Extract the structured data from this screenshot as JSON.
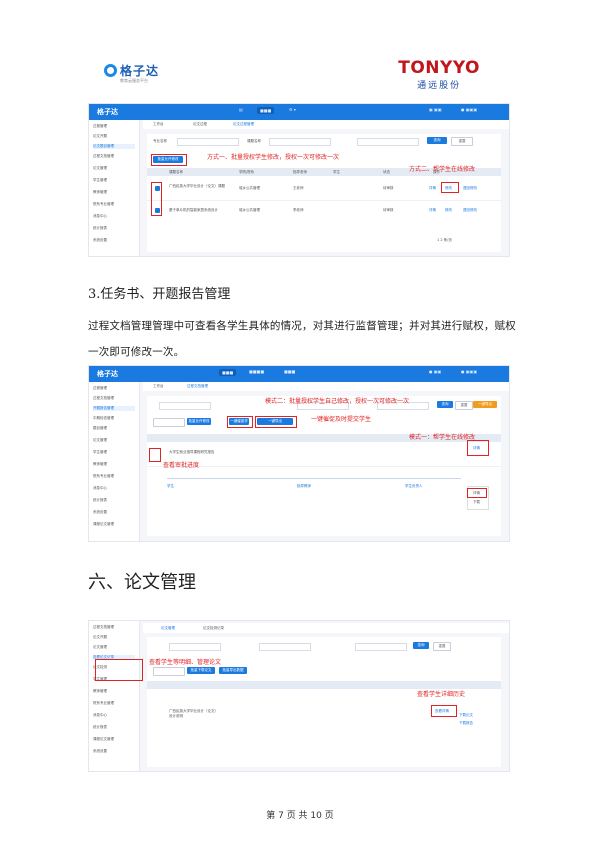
{
  "header": {
    "left_logo_text": "格子达",
    "left_logo_sub": "教育云服务平台",
    "brand_name": "TONYYO",
    "brand_sub": "通远股份"
  },
  "shot1": {
    "app_logo": "格子达",
    "tabs": [
      "工作台",
      "论文过程",
      "论文过程管理"
    ],
    "sidebar": [
      "过程管理",
      "论文开题",
      "论文题目管理",
      "过程文档管理",
      "论文管理",
      "学生管理",
      "教师管理",
      "院系专业管理",
      "消息中心",
      "统计报表",
      "系统设置"
    ],
    "search_label": "专业名称",
    "search_label2": "课题名称",
    "search_btn": "查询",
    "reset_btn": "重置",
    "bulk_btn": "批量允许修改",
    "note1": "方式一、批量授权学生修改，授权一次可修改一次",
    "note2": "方式二、帮学生在线修改",
    "columns": [
      "课题名称",
      "学院/院系",
      "指导老师",
      "学生",
      "状态",
      "操作"
    ],
    "rows": [
      {
        "title": "广西民族大学毕业设计（论文）课题",
        "dept": "城乡公共管理",
        "teacher": "王老师",
        "status": "待审核"
      },
      {
        "title": "基于单片机的智能家居系统设计",
        "dept": "城乡公共管理",
        "teacher": "李老师",
        "status": "待审核"
      }
    ],
    "actions": [
      "详情",
      "修改",
      "退回修改"
    ],
    "pager": "1 2 条/页"
  },
  "section3": {
    "heading": "3.任务书、开题报告管理",
    "para_line1": "过程文档管理管理中可查看各学生具体的情况，对其进行监督管理；并对其进行赋权，赋权",
    "para_line2": "一次即可修改一次。"
  },
  "shot2": {
    "tabs": [
      "工作台",
      "过程文档管理"
    ],
    "sidebar": [
      "过程管理",
      "过程文档管理",
      "开题报告管理",
      "中期检查管理",
      "题目管理",
      "论文管理",
      "学生管理",
      "教师管理",
      "院系专业管理",
      "消息中心",
      "统计报表",
      "系统设置",
      "课程论文管理"
    ],
    "btns": [
      "批量允许修改",
      "一键催促学生",
      "一键导出"
    ],
    "note1": "模式二：批量授权学生自己修改，授权一次可修改一次",
    "note2": "一键催促及时提交学生",
    "note3": "模式一：帮学生在线修改",
    "note4": "查看审批进度",
    "row_title": "大学生就业指导课程研究报告",
    "timeline": [
      "学生",
      "指导教师",
      "学生负责人"
    ],
    "menu": [
      "详情",
      "下载"
    ]
  },
  "section6": {
    "heading": "六、论文管理"
  },
  "shot3": {
    "tabs": [
      "论文管理",
      "论文检测记录"
    ],
    "sidebar": [
      "过程文档管理",
      "论文开题",
      "论文管理",
      "查看论文记录",
      "论文检测",
      "学生管理",
      "教师管理",
      "院系专业管理",
      "消息中心",
      "统计报表",
      "课程论文管理",
      "系统设置"
    ],
    "btns": [
      "批量允许修改",
      "批量下载论文",
      "批量导出数据"
    ],
    "note1": "查看学生等明细、管理论文",
    "note2": "查看学生详细历史",
    "row_title": "广西民族大学毕业设计（论文）设计说明",
    "actions": [
      "查看详情",
      "下载论文",
      "下载报告"
    ]
  },
  "footer": {
    "text": "第 7 页 共 10 页"
  },
  "colors": {
    "brand_red": "#c0161c",
    "app_blue": "#1b7ae0",
    "annotation_red": "#e02424"
  }
}
